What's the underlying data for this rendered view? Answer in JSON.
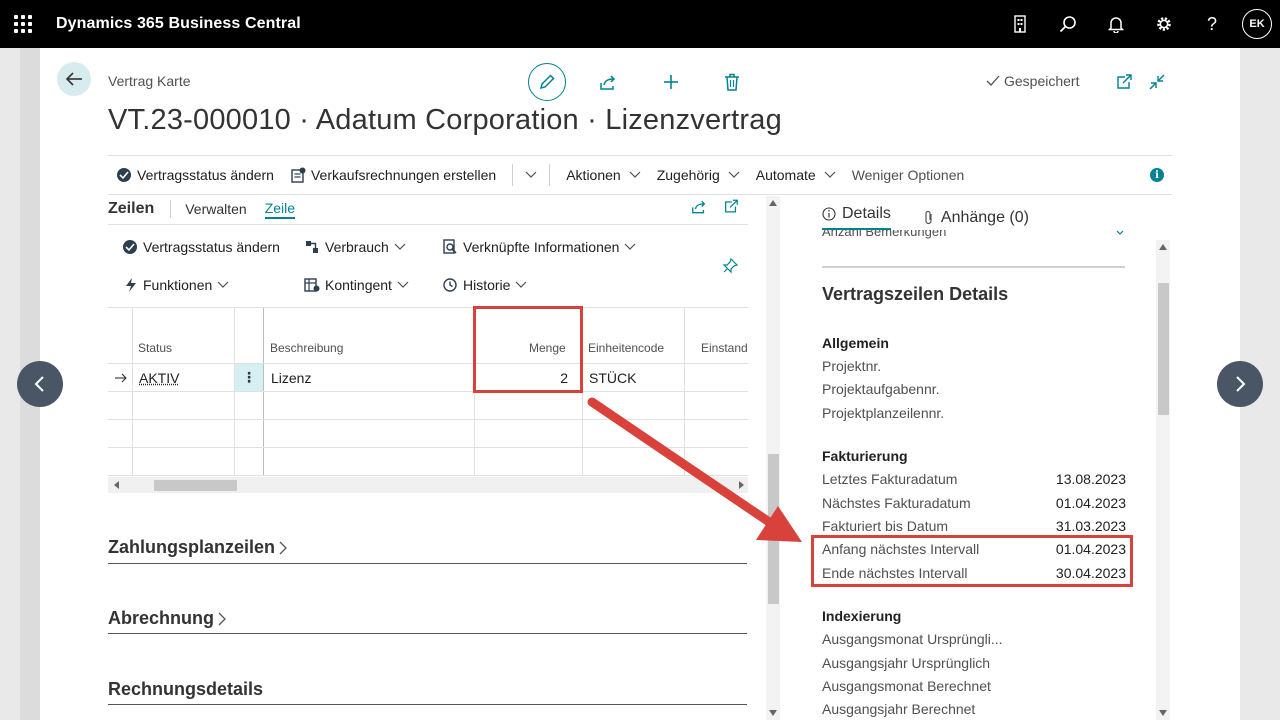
{
  "app": {
    "title": "Dynamics 365 Business Central",
    "user_initials": "EK"
  },
  "header": {
    "breadcrumb": "Vertrag Karte",
    "title": "VT.23-000010 · Adatum Corporation · Lizenzvertrag",
    "saved_label": "Gespeichert"
  },
  "actionbar": {
    "items": [
      "Vertragsstatus ändern",
      "Verkaufsrechnungen erstellen",
      "Aktionen",
      "Zugehörig",
      "Automate",
      "Weniger Optionen"
    ]
  },
  "lines": {
    "title": "Zeilen",
    "tabs": [
      "Verwalten",
      "Zeile"
    ],
    "sub_actions": [
      "Vertragsstatus ändern",
      "Verbrauch",
      "Verknüpfte Informationen",
      "Funktionen",
      "Kontingent",
      "Historie"
    ],
    "columns": [
      "Status",
      "Beschreibung",
      "Menge",
      "Einheitencode",
      "Einstands"
    ],
    "rows": [
      {
        "status": "AKTIV",
        "beschreibung": "Lizenz",
        "menge": "2",
        "einheitencode": "STÜCK"
      }
    ]
  },
  "sections": [
    "Zahlungsplanzeilen",
    "Abrechnung",
    "Rechnungsdetails"
  ],
  "factbox": {
    "tabs": [
      "Details",
      "Anhänge (0)"
    ],
    "cut_label": "Anzahl Bemerkungen",
    "title": "Vertragszeilen Details",
    "groups": [
      {
        "name": "Allgemein",
        "rows": [
          {
            "label": "Projektnr.",
            "value": ""
          },
          {
            "label": "Projektaufgabennr.",
            "value": ""
          },
          {
            "label": "Projektplanzeilennr.",
            "value": ""
          }
        ]
      },
      {
        "name": "Fakturierung",
        "rows": [
          {
            "label": "Letztes Fakturadatum",
            "value": "13.08.2023"
          },
          {
            "label": "Nächstes Fakturadatum",
            "value": "01.04.2023"
          },
          {
            "label": "Fakturiert bis Datum",
            "value": "31.03.2023"
          },
          {
            "label": "Anfang nächstes Intervall",
            "value": "01.04.2023"
          },
          {
            "label": "Ende nächstes Intervall",
            "value": "30.04.2023"
          }
        ]
      },
      {
        "name": "Indexierung",
        "rows": [
          {
            "label": "Ausgangsmonat Ursprüngli...",
            "value": ""
          },
          {
            "label": "Ausgangsjahr Ursprünglich",
            "value": ""
          },
          {
            "label": "Ausgangsmonat Berechnet",
            "value": ""
          },
          {
            "label": "Ausgangsjahr Berechnet",
            "value": ""
          }
        ]
      }
    ]
  },
  "colors": {
    "accent": "#00838f",
    "highlight": "#d9413b",
    "topbar": "#000000"
  }
}
